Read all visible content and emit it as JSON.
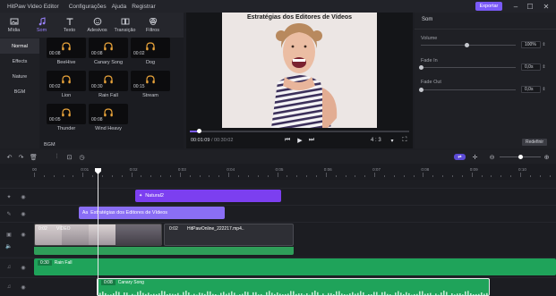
{
  "menu": {
    "app_title": "HitPaw Video Editor",
    "items": [
      "Configurações",
      "Ajuda",
      "Registrar"
    ],
    "export_label": "Exportar"
  },
  "tabs": [
    {
      "label": "Mídia",
      "icon": "media-icon"
    },
    {
      "label": "Som",
      "icon": "music-note-icon",
      "active": true
    },
    {
      "label": "Texto",
      "icon": "text-icon"
    },
    {
      "label": "Adesivos",
      "icon": "sticker-icon"
    },
    {
      "label": "Transição",
      "icon": "transition-icon"
    },
    {
      "label": "Filtros",
      "icon": "filter-icon"
    }
  ],
  "categories": [
    {
      "label": "Normal",
      "active": true
    },
    {
      "label": "Effects"
    },
    {
      "label": "Nature"
    },
    {
      "label": "BGM"
    }
  ],
  "sounds": [
    {
      "name": "BeeHive",
      "duration": "00:08"
    },
    {
      "name": "Canary Song",
      "duration": "00:08"
    },
    {
      "name": "Dog",
      "duration": "00:02"
    },
    {
      "name": "Lion",
      "duration": "00:02"
    },
    {
      "name": "Rain Fall",
      "duration": "00:30"
    },
    {
      "name": "Stream",
      "duration": "00:15"
    },
    {
      "name": "Thunder",
      "duration": "00:05"
    },
    {
      "name": "Wind Heavy",
      "duration": "00:08"
    }
  ],
  "bgm_label": "BGM",
  "preview": {
    "overlay_title": "Estratégias dos Editores de Vídeos",
    "current_time": "00:01:09",
    "total_time": "00:30:02",
    "progress_fraction": 0.04,
    "aspect_ratio": "4 : 3"
  },
  "panel": {
    "title": "Som",
    "volume_label": "Volume",
    "volume_value": "100%",
    "volume_fraction": 0.5,
    "fade_in_label": "Fade In",
    "fade_in_value": "0,0s",
    "fade_out_label": "Fade Out",
    "fade_out_value": "0,0s",
    "reset_label": "Redefinir"
  },
  "ruler_ticks": [
    "00",
    "0:01",
    "0:02",
    "0:03",
    "0:04",
    "0:05",
    "0:06",
    "0:07",
    "0:08",
    "0:09",
    "0:10"
  ],
  "tracks": {
    "effect_clip": "Natural2",
    "text_clip": "Estratégias dos Editores de Vídeos",
    "video_clip_1_time": "0:02",
    "video_clip_1_label": "VIDEO",
    "video_clip_2_time": "0:02",
    "video_clip_2_name": "HitPawOnline_222217.mp4..",
    "audio_1_time": "0:30",
    "audio_1_name": "Rain Fall",
    "audio_2_time": "0:08",
    "audio_2_name": "Canary Song"
  },
  "colors": {
    "accent": "#7a5af8",
    "effect_clip": "#7c3ff0",
    "text_clip": "#8a6ef5",
    "audio_clip": "#1fa35a",
    "video_track": "#2f9e59"
  }
}
